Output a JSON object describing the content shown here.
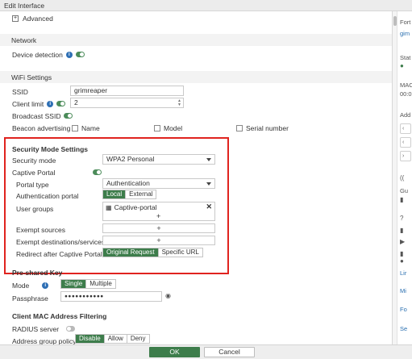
{
  "window": {
    "title": "Edit Interface"
  },
  "advanced": {
    "label": "Advanced"
  },
  "network": {
    "header": "Network",
    "device_detection_label": "Device detection"
  },
  "wifi": {
    "header": "WiFi Settings",
    "ssid_label": "SSID",
    "ssid_value": "grimreaper",
    "client_limit_label": "Client limit",
    "client_limit_value": "2",
    "broadcast_ssid_label": "Broadcast SSID",
    "beacon_label": "Beacon advertising",
    "beacon_options": [
      "Name",
      "Model",
      "Serial number"
    ]
  },
  "security": {
    "header": "Security Mode Settings",
    "mode_label": "Security mode",
    "mode_value": "WPA2 Personal",
    "captive_label": "Captive Portal",
    "portal_type_label": "Portal type",
    "portal_type_value": "Authentication",
    "auth_portal_label": "Authentication portal",
    "auth_portal_options": [
      "Local",
      "External"
    ],
    "user_groups_label": "User groups",
    "user_group_item": "Captive-portal",
    "exempt_sources_label": "Exempt sources",
    "exempt_dest_label": "Exempt destinations/services",
    "redirect_label": "Redirect after Captive Portal",
    "redirect_options": [
      "Original Request",
      "Specific URL"
    ]
  },
  "psk": {
    "header": "Pre-shared Key",
    "mode_label": "Mode",
    "mode_options": [
      "Single",
      "Multiple"
    ],
    "passphrase_label": "Passphrase",
    "passphrase_value": "●●●●●●●●●●●"
  },
  "mac": {
    "header": "Client MAC Address Filtering",
    "radius_label": "RADIUS server",
    "group_policy_label": "Address group policy",
    "group_policy_options": [
      "Disable",
      "Allow",
      "Deny"
    ]
  },
  "footer": {
    "ok": "OK",
    "cancel": "Cancel"
  },
  "right_panel": {
    "t1": "Fort",
    "t2": "gim",
    "t3": "Stat",
    "t4": "MAC",
    "t5": "00:0",
    "t6": "Add",
    "t7": "Gu",
    "t8": "Lir",
    "t9": "Mi",
    "t10": "Fo",
    "t11": "Se"
  },
  "colors": {
    "accent_green": "#3d7d4b",
    "highlight_red": "#e0231f",
    "info_blue": "#2e6fb4"
  }
}
